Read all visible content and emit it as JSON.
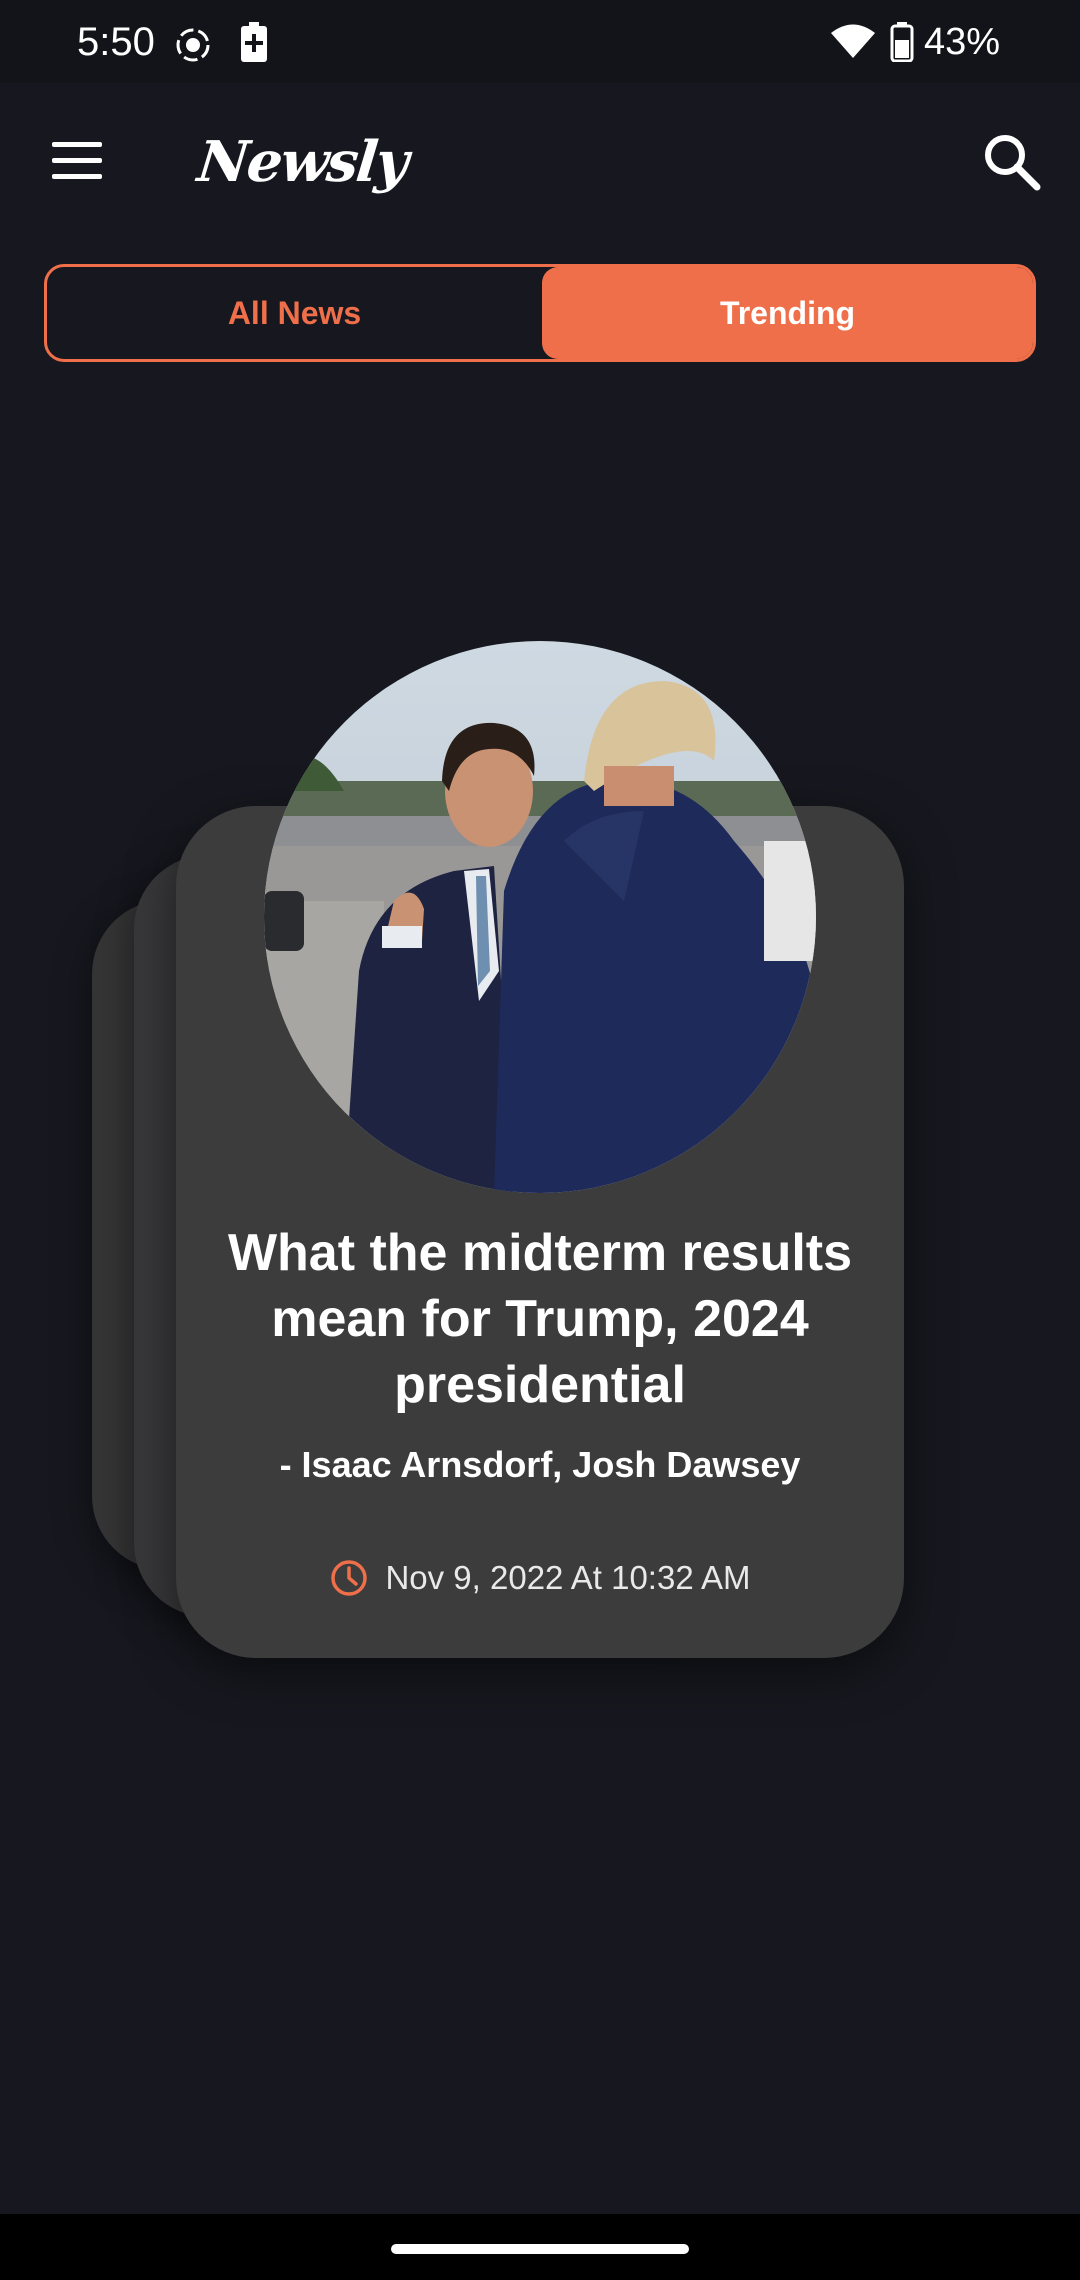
{
  "status_bar": {
    "time": "5:50",
    "battery_percent": "43%",
    "icons": [
      "screen-record-icon",
      "battery-saver-icon",
      "wifi-icon",
      "battery-icon"
    ]
  },
  "app_bar": {
    "title": "Newsly",
    "menu_icon": "menu-icon",
    "search_icon": "search-icon"
  },
  "tabs": {
    "items": [
      {
        "label": "All News",
        "selected": false
      },
      {
        "label": "Trending",
        "selected": true
      }
    ]
  },
  "article": {
    "headline": "What the midterm results mean for Trump, 2024 presidential",
    "authors": "- Isaac Arnsdorf, Josh Dawsey",
    "date": "Nov 9, 2022 At 10:32 AM",
    "date_icon": "clock-icon"
  },
  "colors": {
    "accent": "#ef6f4a",
    "background": "#17181f",
    "card": "#3c3c3d"
  }
}
